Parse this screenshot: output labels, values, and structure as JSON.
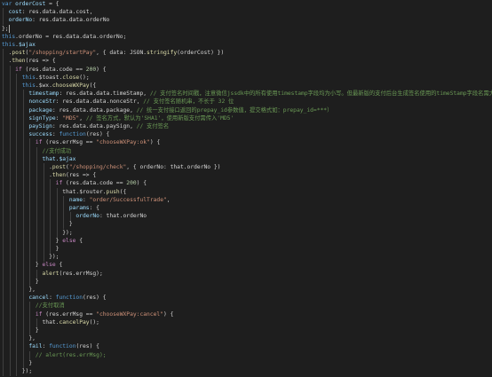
{
  "editor": {
    "colors": {
      "background": "#1e1e1e",
      "keyword": "#569cd6",
      "control": "#c586c0",
      "variable": "#9cdcfe",
      "function": "#dcdcaa",
      "string": "#ce9178",
      "number": "#b5cea8",
      "comment": "#6a9955",
      "punctuation": "#d4d4d4"
    },
    "lines": [
      [
        {
          "t": "var ",
          "c": "kw"
        },
        {
          "t": "orderCost",
          "c": "var"
        },
        {
          "t": " = {",
          "c": "punc"
        }
      ],
      [
        {
          "t": "  cost",
          "c": "var"
        },
        {
          "t": ": res.data.data.cost,",
          "c": "punc"
        }
      ],
      [
        {
          "t": "  orderNo",
          "c": "var"
        },
        {
          "t": ": res.data.data.orderNo",
          "c": "punc"
        }
      ],
      [
        {
          "t": "};",
          "c": "punc"
        }
      ],
      [
        {
          "t": "this",
          "c": "kw"
        },
        {
          "t": ".orderNo = res.data.data.orderNo;",
          "c": "punc"
        }
      ],
      [
        {
          "t": "this",
          "c": "kw"
        },
        {
          "t": ".$ajax",
          "c": "var"
        }
      ],
      [
        {
          "t": "  .",
          "c": "punc"
        },
        {
          "t": "post",
          "c": "fn"
        },
        {
          "t": "(",
          "c": "punc"
        },
        {
          "t": "\"/shopping/startPay\"",
          "c": "str"
        },
        {
          "t": ", { data: JSON.",
          "c": "punc"
        },
        {
          "t": "stringify",
          "c": "fn"
        },
        {
          "t": "(orderCost) })",
          "c": "punc"
        }
      ],
      [
        {
          "t": "  .",
          "c": "punc"
        },
        {
          "t": "then",
          "c": "fn"
        },
        {
          "t": "(res => {",
          "c": "punc"
        }
      ],
      [
        {
          "t": "    ",
          "c": "punc"
        },
        {
          "t": "if",
          "c": "ctl"
        },
        {
          "t": " (res.data.code == ",
          "c": "punc"
        },
        {
          "t": "200",
          "c": "num"
        },
        {
          "t": ") {",
          "c": "punc"
        }
      ],
      [
        {
          "t": "      ",
          "c": "punc"
        },
        {
          "t": "this",
          "c": "kw"
        },
        {
          "t": ".$toast.",
          "c": "punc"
        },
        {
          "t": "close",
          "c": "fn"
        },
        {
          "t": "();",
          "c": "punc"
        }
      ],
      [
        {
          "t": "      ",
          "c": "punc"
        },
        {
          "t": "this",
          "c": "kw"
        },
        {
          "t": ".$wx.",
          "c": "punc"
        },
        {
          "t": "chooseWXPay",
          "c": "fn"
        },
        {
          "t": "({",
          "c": "punc"
        }
      ],
      [
        {
          "t": "        timestamp",
          "c": "var"
        },
        {
          "t": ": res.data.data.timeStamp, ",
          "c": "punc"
        },
        {
          "t": "// 支付签名时间戳，注意微信jssdk中的所有使用timestamp字段均为小写。但最新版的支付后台生成签名使用的timeStamp字段名需大写其中的S字符",
          "c": "com"
        }
      ],
      [
        {
          "t": "        nonceStr",
          "c": "var"
        },
        {
          "t": ": res.data.data.nonceStr, ",
          "c": "punc"
        },
        {
          "t": "// 支付签名随机串，不长于 32 位",
          "c": "com"
        }
      ],
      [
        {
          "t": "        package",
          "c": "var"
        },
        {
          "t": ": res.data.data.package, ",
          "c": "punc"
        },
        {
          "t": "// 统一支付接口返回的prepay_id参数值，提交格式如：prepay_id=***）",
          "c": "com"
        }
      ],
      [
        {
          "t": "        signType",
          "c": "var"
        },
        {
          "t": ": ",
          "c": "punc"
        },
        {
          "t": "\"MD5\"",
          "c": "str"
        },
        {
          "t": ", ",
          "c": "punc"
        },
        {
          "t": "// 签名方式，默认为'SHA1'，使用新版支付需传入'MD5'",
          "c": "com"
        }
      ],
      [
        {
          "t": "        paySign",
          "c": "var"
        },
        {
          "t": ": res.data.data.paySign, ",
          "c": "punc"
        },
        {
          "t": "// 支付签名",
          "c": "com"
        }
      ],
      [
        {
          "t": "        success",
          "c": "var"
        },
        {
          "t": ": ",
          "c": "punc"
        },
        {
          "t": "function",
          "c": "kw"
        },
        {
          "t": "(res) {",
          "c": "punc"
        }
      ],
      [
        {
          "t": "          ",
          "c": "punc"
        },
        {
          "t": "if",
          "c": "ctl"
        },
        {
          "t": " (res.errMsg == ",
          "c": "punc"
        },
        {
          "t": "\"chooseWXPay:ok\"",
          "c": "str"
        },
        {
          "t": ") {",
          "c": "punc"
        }
      ],
      [
        {
          "t": "            ",
          "c": "punc"
        },
        {
          "t": "//支付成功",
          "c": "com"
        }
      ],
      [
        {
          "t": "            that.$ajax",
          "c": "var"
        }
      ],
      [
        {
          "t": "              .",
          "c": "punc"
        },
        {
          "t": "post",
          "c": "fn"
        },
        {
          "t": "(",
          "c": "punc"
        },
        {
          "t": "\"/shopping/check\"",
          "c": "str"
        },
        {
          "t": ", { orderNo: that.orderNo })",
          "c": "punc"
        }
      ],
      [
        {
          "t": "              .",
          "c": "punc"
        },
        {
          "t": "then",
          "c": "fn"
        },
        {
          "t": "(res => {",
          "c": "punc"
        }
      ],
      [
        {
          "t": "                ",
          "c": "punc"
        },
        {
          "t": "if",
          "c": "ctl"
        },
        {
          "t": " (res.data.code == ",
          "c": "punc"
        },
        {
          "t": "200",
          "c": "num"
        },
        {
          "t": ") {",
          "c": "punc"
        }
      ],
      [
        {
          "t": "                  that.$router.",
          "c": "punc"
        },
        {
          "t": "push",
          "c": "fn"
        },
        {
          "t": "({",
          "c": "punc"
        }
      ],
      [
        {
          "t": "                    name",
          "c": "var"
        },
        {
          "t": ": ",
          "c": "punc"
        },
        {
          "t": "\"order/SuccessfulTrade\"",
          "c": "str"
        },
        {
          "t": ",",
          "c": "punc"
        }
      ],
      [
        {
          "t": "                    params",
          "c": "var"
        },
        {
          "t": ": {",
          "c": "punc"
        }
      ],
      [
        {
          "t": "                      orderNo",
          "c": "var"
        },
        {
          "t": ": that.orderNo",
          "c": "punc"
        }
      ],
      [
        {
          "t": "                    }",
          "c": "punc"
        }
      ],
      [
        {
          "t": "                  });",
          "c": "punc"
        }
      ],
      [
        {
          "t": "                } ",
          "c": "punc"
        },
        {
          "t": "else",
          "c": "ctl"
        },
        {
          "t": " {",
          "c": "punc"
        }
      ],
      [
        {
          "t": "                }",
          "c": "punc"
        }
      ],
      [
        {
          "t": "              });",
          "c": "punc"
        }
      ],
      [
        {
          "t": "          } ",
          "c": "punc"
        },
        {
          "t": "else",
          "c": "ctl"
        },
        {
          "t": " {",
          "c": "punc"
        }
      ],
      [
        {
          "t": "            ",
          "c": "punc"
        },
        {
          "t": "alert",
          "c": "fn"
        },
        {
          "t": "(res.errMsg);",
          "c": "punc"
        }
      ],
      [
        {
          "t": "          }",
          "c": "punc"
        }
      ],
      [
        {
          "t": "        },",
          "c": "punc"
        }
      ],
      [
        {
          "t": "        cancel",
          "c": "var"
        },
        {
          "t": ": ",
          "c": "punc"
        },
        {
          "t": "function",
          "c": "kw"
        },
        {
          "t": "(res) {",
          "c": "punc"
        }
      ],
      [
        {
          "t": "          ",
          "c": "punc"
        },
        {
          "t": "//支付取消",
          "c": "com"
        }
      ],
      [
        {
          "t": "          ",
          "c": "punc"
        },
        {
          "t": "if",
          "c": "ctl"
        },
        {
          "t": " (res.errMsg == ",
          "c": "punc"
        },
        {
          "t": "\"chooseWXPay:cancel\"",
          "c": "str"
        },
        {
          "t": ") {",
          "c": "punc"
        }
      ],
      [
        {
          "t": "            that.",
          "c": "punc"
        },
        {
          "t": "cancelPay",
          "c": "fn"
        },
        {
          "t": "();",
          "c": "punc"
        }
      ],
      [
        {
          "t": "          }",
          "c": "punc"
        }
      ],
      [
        {
          "t": "        },",
          "c": "punc"
        }
      ],
      [
        {
          "t": "        fail",
          "c": "var"
        },
        {
          "t": ": ",
          "c": "punc"
        },
        {
          "t": "function",
          "c": "kw"
        },
        {
          "t": "(res) {",
          "c": "punc"
        }
      ],
      [
        {
          "t": "          ",
          "c": "punc"
        },
        {
          "t": "// alert(res.errMsg);",
          "c": "com"
        }
      ],
      [
        {
          "t": "        }",
          "c": "punc"
        }
      ],
      [
        {
          "t": "      });",
          "c": "punc"
        }
      ]
    ]
  }
}
